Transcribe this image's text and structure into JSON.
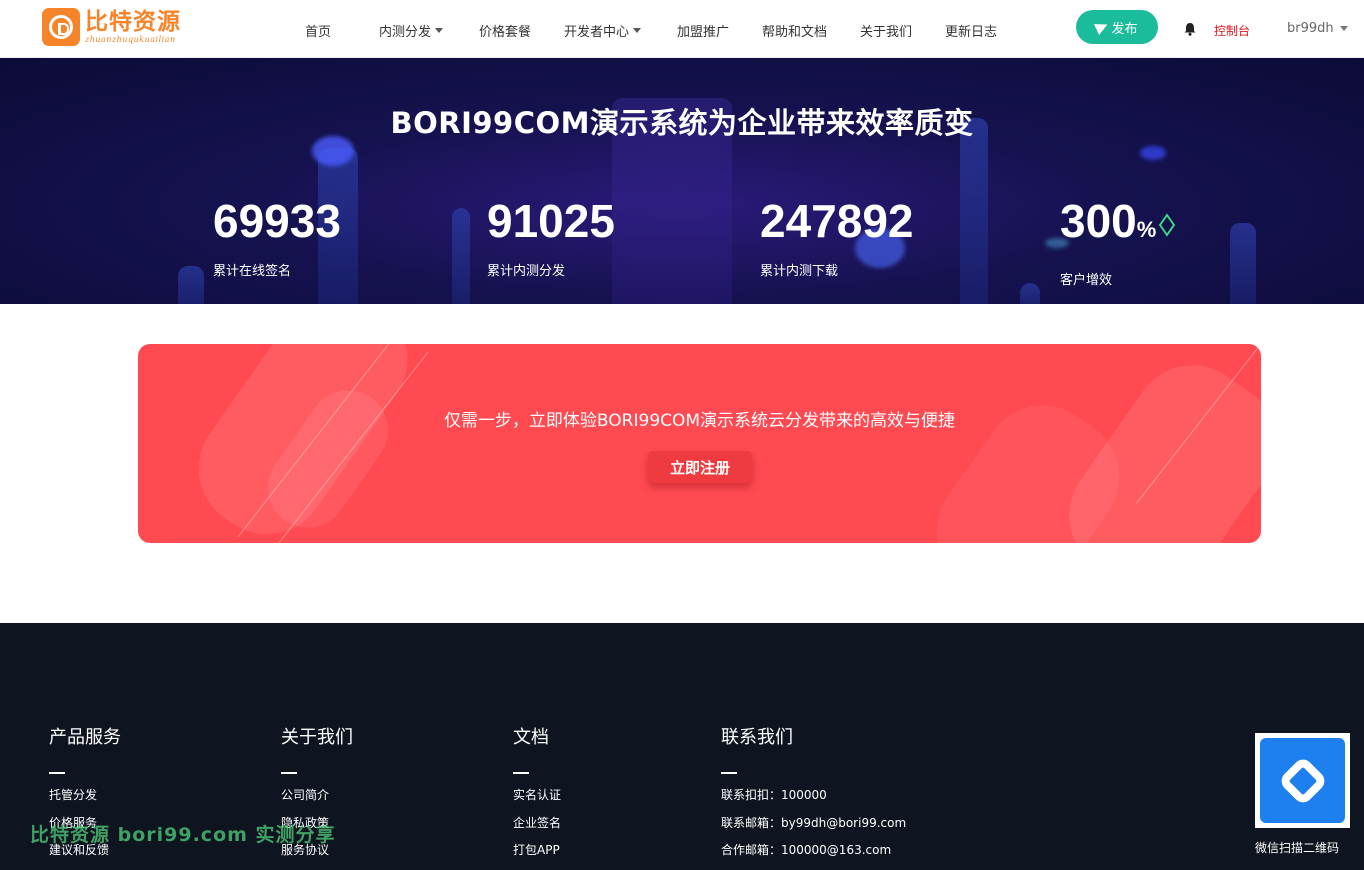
{
  "brand": {
    "logo_title": "比特资源",
    "logo_sub": "zhuanzhuqukuailian",
    "colors": {
      "brand": "#f5842a",
      "accent": "#1bbc9b",
      "cta": "#ff4a51",
      "footer": "#0f1421"
    }
  },
  "nav": {
    "items": [
      {
        "label": "首页",
        "dropdown": false
      },
      {
        "label": "内测分发",
        "dropdown": true
      },
      {
        "label": "价格套餐",
        "dropdown": false
      },
      {
        "label": "开发者中心",
        "dropdown": true
      },
      {
        "label": "加盟推广",
        "dropdown": false
      },
      {
        "label": "帮助和文档",
        "dropdown": false
      },
      {
        "label": "关于我们",
        "dropdown": false
      },
      {
        "label": "更新日志",
        "dropdown": false
      }
    ],
    "publish_label": "发布",
    "console_label": "控制台",
    "username": "br99dh"
  },
  "hero": {
    "title": "BORI99COM演示系统为企业带来效率质变",
    "stats": [
      {
        "value": "69933",
        "unit": "",
        "label": "累计在线签名"
      },
      {
        "value": "91025",
        "unit": "",
        "label": "累计内测分发"
      },
      {
        "value": "247892",
        "unit": "",
        "label": "累计内测下载"
      },
      {
        "value": "300",
        "unit": "%",
        "label": "客户增效"
      }
    ]
  },
  "cta": {
    "text": "仅需一步，立即体验BORI99COM演示系统云分发带来的高效与便捷",
    "button_label": "立即注册"
  },
  "footer": {
    "columns": [
      {
        "title": "产品服务",
        "links": [
          "托管分发",
          "价格服务",
          "建议和反馈"
        ]
      },
      {
        "title": "关于我们",
        "links": [
          "公司简介",
          "隐私政策",
          "服务协议"
        ]
      },
      {
        "title": "文档",
        "links": [
          "实名认证",
          "企业签名",
          "打包APP"
        ]
      },
      {
        "title": "联系我们",
        "links": [
          "联系扣扣：100000",
          "联系邮箱：by99dh@bori99.com",
          "合作邮箱：100000@163.com"
        ]
      }
    ],
    "qr_caption": "微信扫描二维码"
  },
  "watermark": "比特资源 bori99.com 实测分享"
}
